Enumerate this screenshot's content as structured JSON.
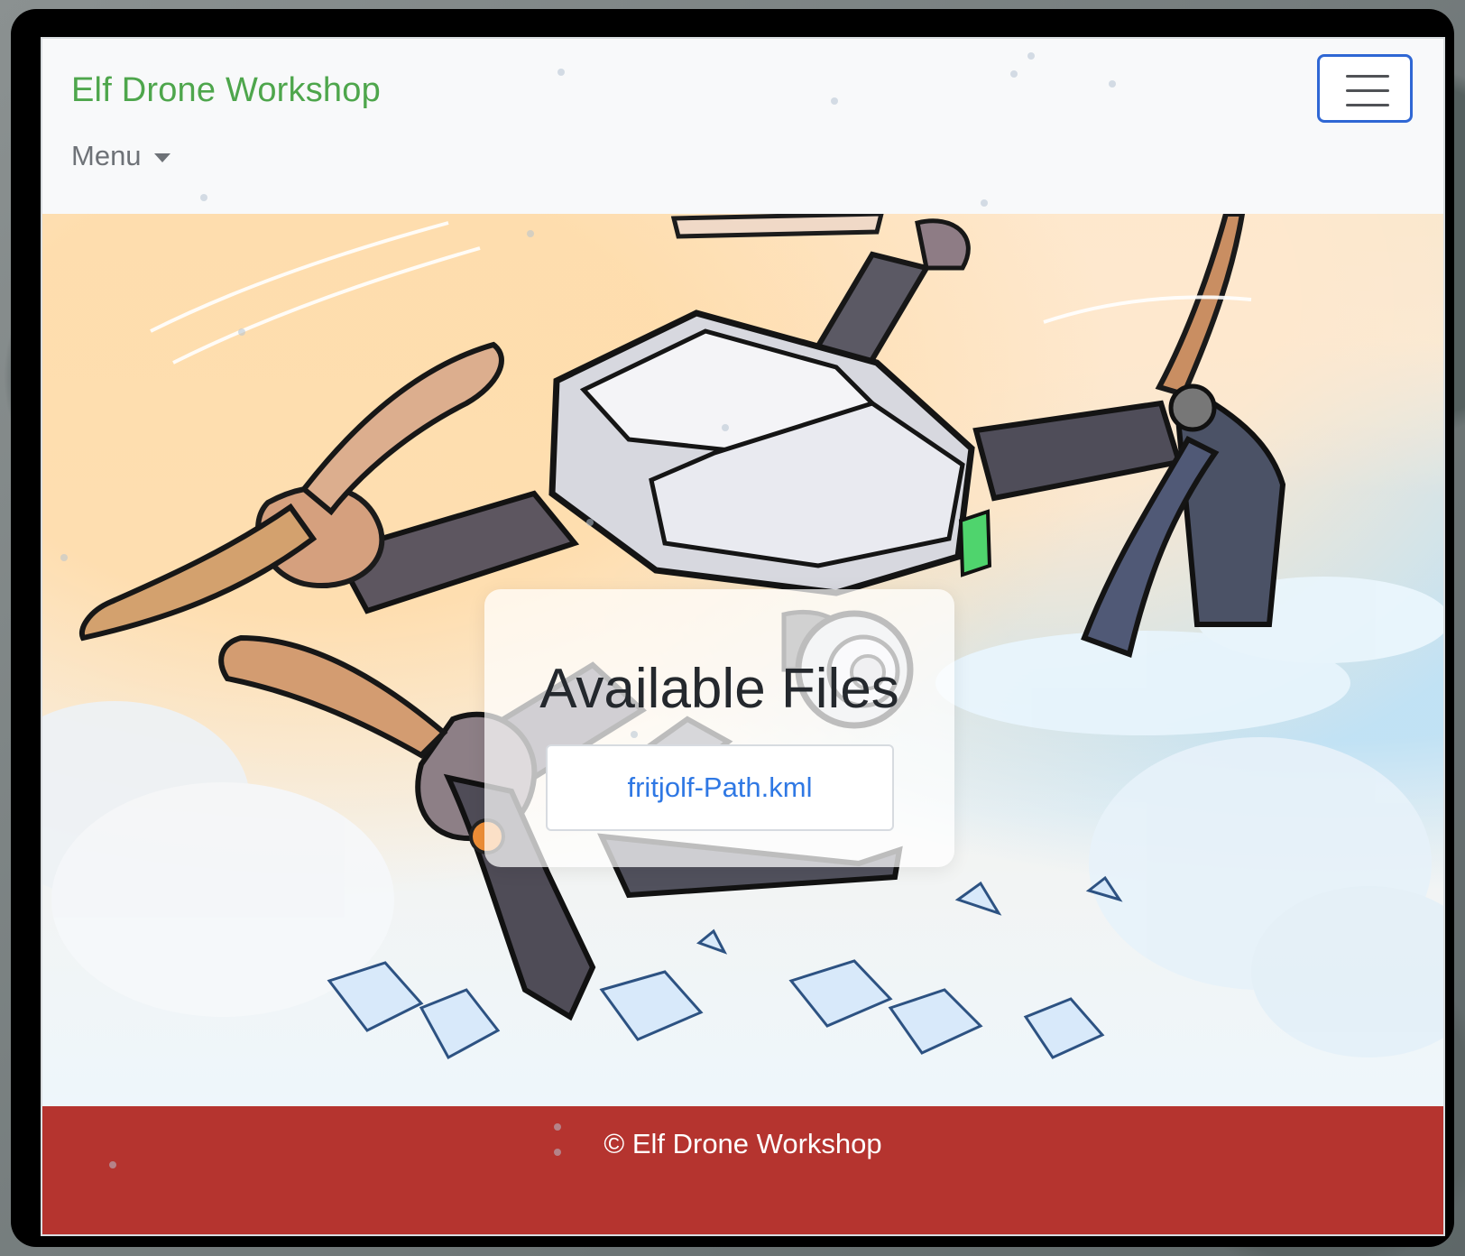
{
  "navbar": {
    "brand": "Elf Drone Workshop",
    "menu_label": "Menu",
    "toggler_icon": "hamburger-icon",
    "brand_color": "#4ea64c",
    "accent_color": "#2f67d4"
  },
  "hero": {
    "background_image": "drone-illustration",
    "files_card": {
      "title": "Available Files",
      "files": [
        {
          "name": "fritjolf-Path.kml"
        }
      ]
    }
  },
  "footer": {
    "text": "© Elf Drone Workshop",
    "background_color": "#b5342f"
  }
}
